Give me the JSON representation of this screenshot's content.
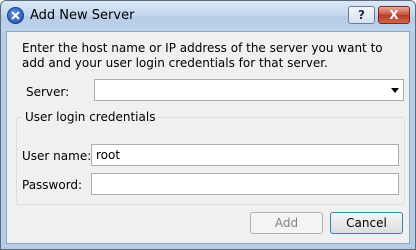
{
  "window": {
    "title": "Add New Server",
    "help_label": "?",
    "close_label": "X"
  },
  "intro_text": "Enter the host name or IP address of the server you want to add and your user login credentials for that server.",
  "server": {
    "label": "Server:",
    "value": ""
  },
  "credentials": {
    "group_title": "User login credentials",
    "username_label": "User name:",
    "username_value": "root",
    "password_label": "Password:",
    "password_value": ""
  },
  "buttons": {
    "add_label": "Add",
    "add_enabled": false,
    "cancel_label": "Cancel"
  },
  "icons": {
    "app": "app-close-icon",
    "dropdown": "chevron-down-icon"
  }
}
